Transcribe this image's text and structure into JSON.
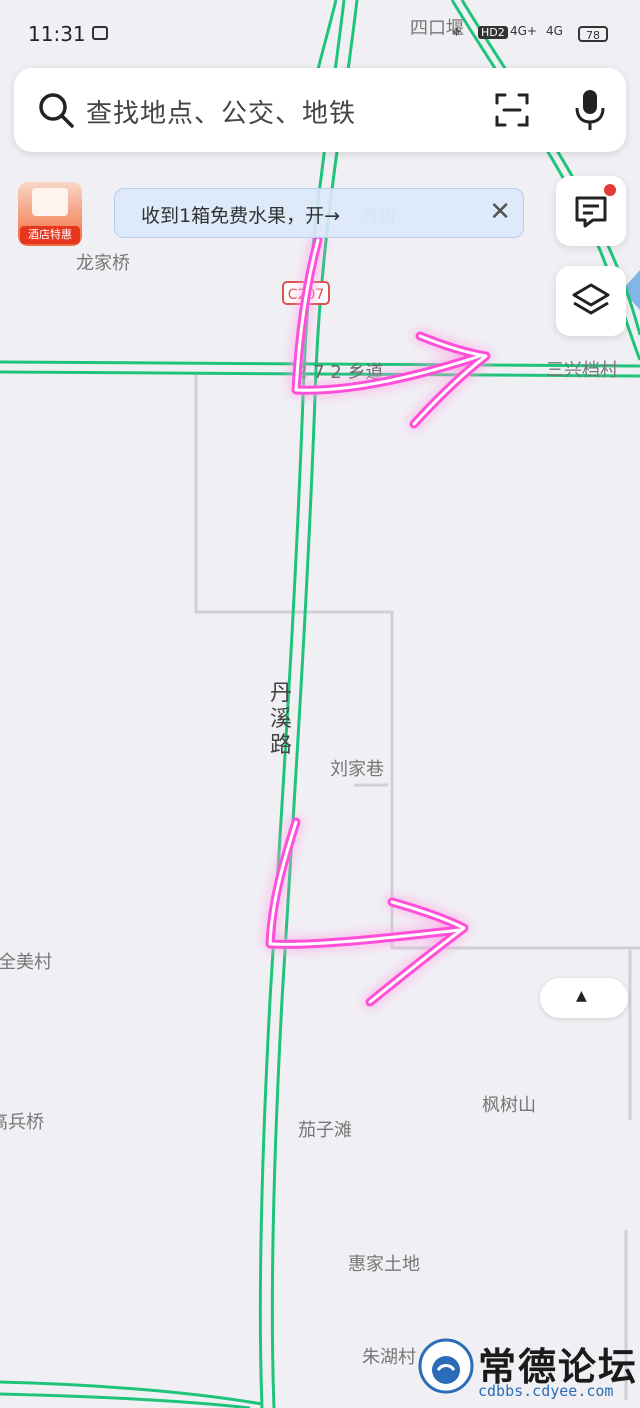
{
  "status_bar": {
    "time": "11:31",
    "network_1": "4G+",
    "network_2": "4G",
    "hd_badge": "HD2",
    "battery": "78"
  },
  "search": {
    "placeholder": "查找地点、公交、地铁",
    "icons": [
      "search-icon",
      "scan-icon",
      "microphone-icon"
    ]
  },
  "promo": {
    "label": "酒店特惠"
  },
  "banner": {
    "text": "收到1箱免费水果，开→",
    "close": "✕"
  },
  "side_buttons": {
    "message_icon": "message-icon",
    "layers_icon": "layers-icon",
    "message_badge_color": "#e53935"
  },
  "map": {
    "road_color": "#1fc47a",
    "road_label_main": "丹溪路",
    "road_shield": "C207",
    "road_label_xiang": "2 7 2 乡道",
    "places": [
      {
        "id": "sikouyan",
        "name": "四口堰"
      },
      {
        "id": "longjiaqiao",
        "name": "龙家桥"
      },
      {
        "id": "shangqiao",
        "name": "商桥"
      },
      {
        "id": "sanxingdang",
        "name": "三兴档村"
      },
      {
        "id": "liujiaxiang",
        "name": "刘家巷"
      },
      {
        "id": "quanmei",
        "name": "全美村"
      },
      {
        "id": "gaobingqiao",
        "name": "高兵桥"
      },
      {
        "id": "fengshushan",
        "name": "枫树山"
      },
      {
        "id": "qiezitan",
        "name": "茄子滩"
      },
      {
        "id": "huijiatudi",
        "name": "惠家土地"
      },
      {
        "id": "zhuhucun",
        "name": "朱湖村"
      }
    ],
    "annotation_color": "#ff4fd8"
  },
  "watermark": {
    "title": "常德论坛",
    "url": "cdbbs.cdyee.com"
  }
}
